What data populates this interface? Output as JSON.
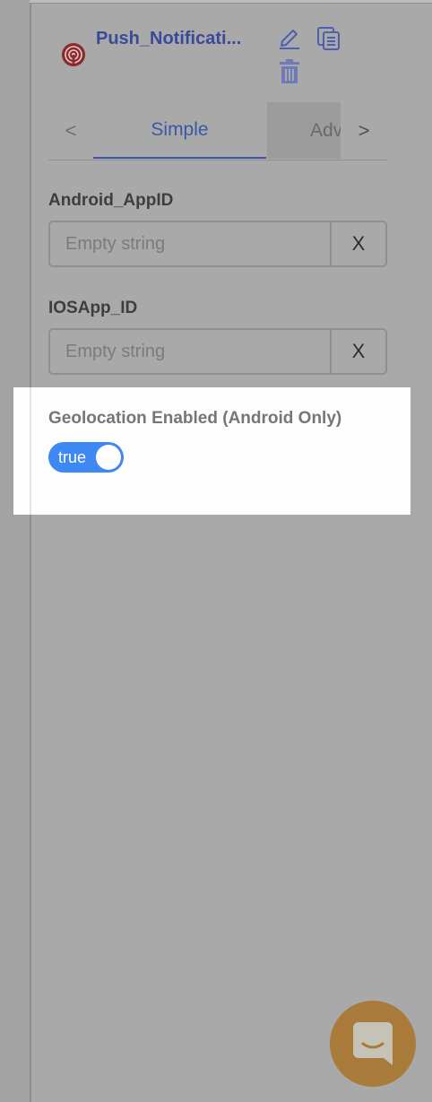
{
  "component": {
    "title": "Push_Notificati...",
    "icon": "broadcast-icon",
    "actions": {
      "edit_icon": "pencil-icon",
      "copy_icon": "copy-icon",
      "delete_icon": "trash-icon"
    }
  },
  "tabs": {
    "prev_glyph": "<",
    "next_glyph": ">",
    "items": [
      {
        "label": "Simple",
        "active": true
      },
      {
        "label": "Adv",
        "active": false
      }
    ]
  },
  "fields": [
    {
      "label": "Android_AppID",
      "value": "",
      "placeholder": "Empty string",
      "clear_glyph": "X"
    },
    {
      "label": "IOSApp_ID",
      "value": "",
      "placeholder": "Empty string",
      "clear_glyph": "X"
    }
  ],
  "geolocation": {
    "label": "Geolocation Enabled (Android Only)",
    "toggle_text": "true",
    "enabled": true
  },
  "colors": {
    "accent": "#3c57a8",
    "toggle_on": "#3d88f2",
    "chat_button": "#a87b3a"
  }
}
